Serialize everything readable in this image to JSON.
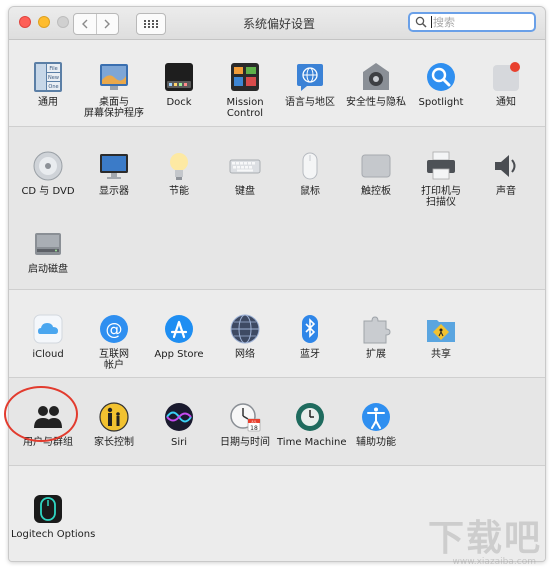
{
  "window": {
    "title": "系统偏好设置",
    "search_placeholder": "搜索",
    "nav_back_icon": "chevron-left-icon",
    "nav_forward_icon": "chevron-right-icon",
    "grid_icon": "grid-icon"
  },
  "colors": {
    "highlight": "#e23b2e",
    "accent": "#6aa0e8"
  },
  "row1": [
    {
      "label": "通用",
      "label2": "",
      "icon": "general-icon"
    },
    {
      "label": "桌面与",
      "label2": "屏幕保护程序",
      "icon": "desktop-icon"
    },
    {
      "label": "Dock",
      "label2": "",
      "icon": "dock-icon"
    },
    {
      "label": "Mission",
      "label2": "Control",
      "icon": "mission-control-icon"
    },
    {
      "label": "语言与地区",
      "label2": "",
      "icon": "language-region-icon"
    },
    {
      "label": "安全性与隐私",
      "label2": "",
      "icon": "security-icon"
    },
    {
      "label": "Spotlight",
      "label2": "",
      "icon": "spotlight-icon"
    },
    {
      "label": "通知",
      "label2": "",
      "icon": "notifications-icon"
    }
  ],
  "row2": [
    {
      "label": "CD 与 DVD",
      "label2": "",
      "icon": "cd-dvd-icon"
    },
    {
      "label": "显示器",
      "label2": "",
      "icon": "display-icon"
    },
    {
      "label": "节能",
      "label2": "",
      "icon": "energy-icon"
    },
    {
      "label": "键盘",
      "label2": "",
      "icon": "keyboard-icon"
    },
    {
      "label": "鼠标",
      "label2": "",
      "icon": "mouse-icon"
    },
    {
      "label": "触控板",
      "label2": "",
      "icon": "trackpad-icon"
    },
    {
      "label": "打印机与",
      "label2": "扫描仪",
      "icon": "printer-icon"
    },
    {
      "label": "声音",
      "label2": "",
      "icon": "sound-icon"
    }
  ],
  "row2b": [
    {
      "label": "启动磁盘",
      "label2": "",
      "icon": "startup-disk-icon"
    }
  ],
  "row3": [
    {
      "label": "iCloud",
      "label2": "",
      "icon": "icloud-icon"
    },
    {
      "label": "互联网",
      "label2": "帐户",
      "icon": "internet-accounts-icon"
    },
    {
      "label": "App Store",
      "label2": "",
      "icon": "app-store-icon"
    },
    {
      "label": "网络",
      "label2": "",
      "icon": "network-icon"
    },
    {
      "label": "蓝牙",
      "label2": "",
      "icon": "bluetooth-icon"
    },
    {
      "label": "扩展",
      "label2": "",
      "icon": "extensions-icon"
    },
    {
      "label": "共享",
      "label2": "",
      "icon": "sharing-icon"
    }
  ],
  "row4": [
    {
      "label": "用户与群组",
      "label2": "",
      "icon": "users-groups-icon"
    },
    {
      "label": "家长控制",
      "label2": "",
      "icon": "parental-controls-icon"
    },
    {
      "label": "Siri",
      "label2": "",
      "icon": "siri-icon"
    },
    {
      "label": "日期与时间",
      "label2": "",
      "icon": "date-time-icon"
    },
    {
      "label": "Time Machine",
      "label2": "",
      "icon": "time-machine-icon"
    },
    {
      "label": "辅助功能",
      "label2": "",
      "icon": "accessibility-icon"
    }
  ],
  "row5": [
    {
      "label": "Logitech Options",
      "label2": "",
      "icon": "logitech-icon"
    }
  ],
  "icon_text": {
    "general_file": "File",
    "general_new": "New",
    "general_one": "One",
    "calendar_month": "JUL",
    "calendar_day": "18"
  },
  "watermark": {
    "text": "下载吧",
    "url": "www.xiazaiba.com"
  }
}
